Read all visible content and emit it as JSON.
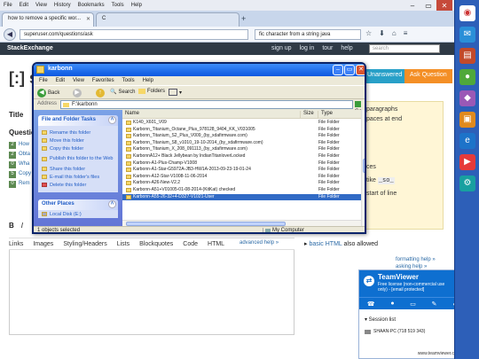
{
  "firefox": {
    "menubar": [
      "File",
      "Edit",
      "View",
      "History",
      "Bookmarks",
      "Tools",
      "Help"
    ],
    "tabs": [
      {
        "label": "how to remove a specific wor..."
      },
      {
        "label": "C"
      }
    ],
    "new_tab": "+",
    "url": "superuser.com/questions/ask",
    "search_value": "fic character from a string java"
  },
  "stackexchange": {
    "brand": "StackExchange",
    "links": [
      "sign up",
      "log in",
      "tour",
      "help"
    ],
    "search_placeholder": "search"
  },
  "site": {
    "logo": "[:] su",
    "tabs": [
      "Unanswered",
      "Ask Question"
    ],
    "title_label": "Title",
    "questions_label": "Question",
    "similar": [
      {
        "n": "2",
        "t": "How"
      },
      {
        "n": "2",
        "t": "Obta"
      },
      {
        "n": "0",
        "t": "Wha"
      },
      {
        "n": "5",
        "t": "Copy"
      },
      {
        "n": "0",
        "t": "Rem"
      }
    ],
    "editor_buttons": [
      "B",
      "I"
    ],
    "editor_links": [
      "Links",
      "Images",
      "Styling/Headers",
      "Lists",
      "Blockquotes",
      "Code",
      "HTML"
    ],
    "advanced_help": "advanced help »",
    "right_panel": {
      "line1": "paragraphs",
      "line2": "paces at end",
      "line3": "ces",
      "line4_pre": "tike ",
      "line4_code": "_so_",
      "line5": "start of line",
      "bullet_link": "basic HTML",
      "bullet_text": "also allowed",
      "formatting_help": "formatting help »",
      "asking_help": "asking help »"
    }
  },
  "explorer": {
    "title": "karbonn",
    "menu": [
      "File",
      "Edit",
      "View",
      "Favorites",
      "Tools",
      "Help"
    ],
    "toolbar": {
      "back": "Back",
      "search": "Search",
      "folders": "Folders"
    },
    "address_label": "Address",
    "address_value": "F:\\karbonn",
    "go": "Go",
    "file_folder_tasks": "File and Folder Tasks",
    "tasks": [
      "Rename this folder",
      "Move this folder",
      "Copy this folder",
      "Publish this folder to the Web",
      "Share this folder",
      "E-mail this folder's files",
      "Delete this folder"
    ],
    "other_places": "Other Places",
    "other_first": "Local Disk (E:)",
    "columns": [
      "Name",
      "Size",
      "Type"
    ],
    "rows": [
      {
        "name": "K140_X601_V09",
        "type": "File Folder"
      },
      {
        "name": "Karbonn_Titanium_Octane_Plus_978128_9404_KK_V031005",
        "type": "File Folder"
      },
      {
        "name": "Karbonn_Titanium_S2_Plus_V009_(by_xdafirmware.com)",
        "type": "File Folder"
      },
      {
        "name": "Karbonn_Titanium_S8_v1010_19-10-2014_(by_xdafirmware.com)",
        "type": "File Folder"
      },
      {
        "name": "Karbonn_Titanium_X_208_091113_(by_xdafirmware.com)",
        "type": "File Folder"
      },
      {
        "name": "KarbonnA12+ Black Jellybean by IndianTitanloverLocked",
        "type": "File Folder"
      },
      {
        "name": "Karbonn-A1-Plus-Champ-V1008",
        "type": "File Folder"
      },
      {
        "name": "Karbonn-A1-Star-G5972A-JB3-HW1A-2013-09-23-19-01-24",
        "type": "File Folder"
      },
      {
        "name": "Karbonn-A12-Star-V1008-11-06-2014",
        "type": "File Folder"
      },
      {
        "name": "Karbonn-A26-New-V2.2",
        "type": "File Folder"
      },
      {
        "name": "Karbonn-A51+V01005-01-08-2014-(KitKat) checked",
        "type": "File Folder"
      },
      {
        "name": "Karbonn-A55-26-32+4-D327-V1021-User",
        "type": "File Folder",
        "selected": true
      }
    ],
    "status_left": "1 objects selected",
    "status_right": "My Computer"
  },
  "teamviewer": {
    "name": "TeamViewer",
    "license": "Free license (non-commercial use only) - [email protected]",
    "close": "✕",
    "icons": [
      "☎",
      "●",
      "▭",
      "✎",
      "✔"
    ],
    "session_list": "▾ Session list",
    "session_item": "SHAAN-PC (718 519 343)",
    "footer": "www.teamviewer.com"
  },
  "window_controls": [
    "–",
    "▭",
    "✕"
  ],
  "colors": {
    "xp_title": "#0a57e0",
    "selection": "#316ac5",
    "teamviewer": "#0e6fd0",
    "se_bar": "#2f3a46",
    "su_unanswered": "#28a0c8",
    "su_ask": "#f48f26"
  }
}
